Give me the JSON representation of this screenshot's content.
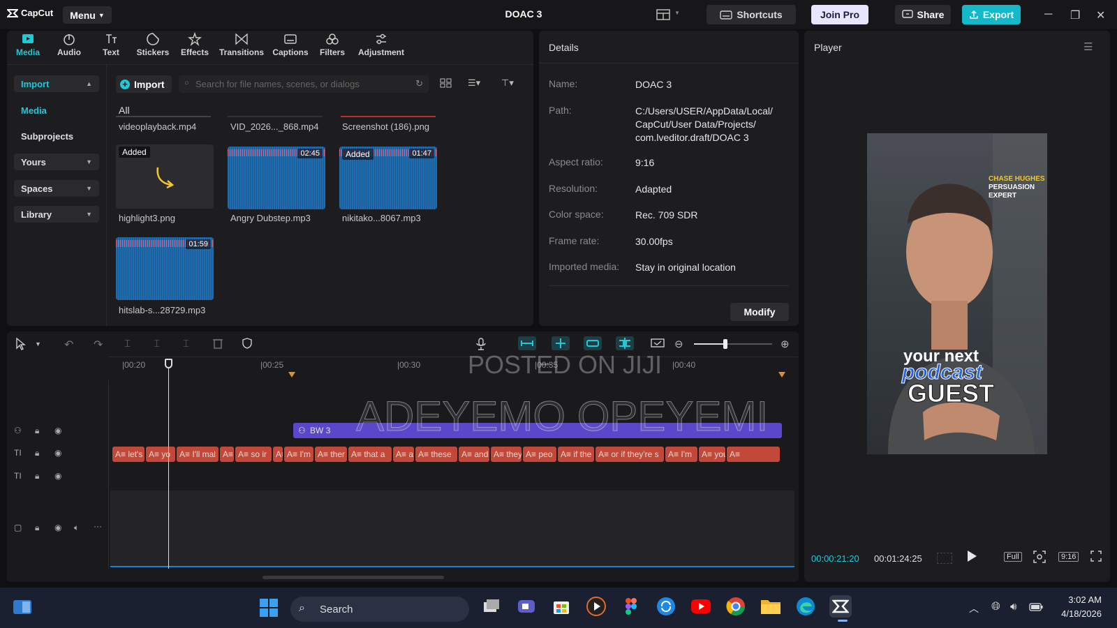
{
  "app": {
    "name": "CapCut",
    "menu_label": "Menu",
    "project_title": "DOAC 3"
  },
  "titlebar": {
    "shortcuts_label": "Shortcuts",
    "join_pro_label": "Join Pro",
    "share_label": "Share",
    "export_label": "Export"
  },
  "toolbar": {
    "tabs": [
      {
        "label": "Media",
        "icon": "media-icon"
      },
      {
        "label": "Audio",
        "icon": "audio-icon"
      },
      {
        "label": "Text",
        "icon": "text-icon"
      },
      {
        "label": "Stickers",
        "icon": "stickers-icon"
      },
      {
        "label": "Effects",
        "icon": "effects-icon"
      },
      {
        "label": "Transitions",
        "icon": "transitions-icon"
      },
      {
        "label": "Captions",
        "icon": "captions-icon"
      },
      {
        "label": "Filters",
        "icon": "filters-icon"
      },
      {
        "label": "Adjustment",
        "icon": "adjustment-icon"
      }
    ]
  },
  "sidebar": {
    "items": [
      {
        "label": "Import"
      },
      {
        "label": "Media"
      },
      {
        "label": "Subprojects"
      },
      {
        "label": "Yours"
      },
      {
        "label": "Spaces"
      },
      {
        "label": "Library"
      }
    ]
  },
  "media": {
    "import_button": "Import",
    "search_placeholder": "Search for file names, scenes, or dialogs",
    "filter_all": "All",
    "top_labels": [
      "videoplayback.mp4",
      "VID_2026..._868.mp4",
      "Screenshot (186).png"
    ],
    "items": [
      {
        "name": "highlight3.png",
        "badge": "Added",
        "duration": ""
      },
      {
        "name": "Angry Dubstep.mp3",
        "badge": "",
        "duration": "02:45"
      },
      {
        "name": "nikitako...8067.mp3",
        "badge": "Added",
        "duration": "01:47"
      },
      {
        "name": "hitslab-s...28729.mp3",
        "badge": "",
        "duration": "01:59"
      }
    ]
  },
  "details": {
    "header": "Details",
    "rows": [
      {
        "key": "Name:",
        "value": "DOAC 3"
      },
      {
        "key": "Path:",
        "value": "C:/Users/USER/AppData/Local/ CapCut/User Data/Projects/ com.lveditor.draft/DOAC 3"
      },
      {
        "key": "Aspect ratio:",
        "value": "9:16"
      },
      {
        "key": "Resolution:",
        "value": "Adapted"
      },
      {
        "key": "Color space:",
        "value": "Rec. 709 SDR"
      },
      {
        "key": "Frame rate:",
        "value": "30.00fps"
      },
      {
        "key": "Imported media:",
        "value": "Stay in original location"
      }
    ],
    "modify_button": "Modify"
  },
  "player": {
    "header": "Player",
    "current_time": "00:00:21:20",
    "total_time": "00:01:24:25",
    "full_label": "Full",
    "ratio_label": "9:16",
    "overlay": {
      "name_line1": "CHASE HUGHES",
      "name_line2": "PERSUASION",
      "name_line3": "EXPERT",
      "line1": "your next",
      "line2": "podcast",
      "line3": "GUEST"
    }
  },
  "timeline": {
    "ruler": [
      "00:20",
      "00:25",
      "00:30",
      "00:35",
      "00:40"
    ],
    "effect_clip_label": "BW 3",
    "caption_clips": [
      "let's",
      "yo",
      "I'll mal",
      "",
      "so ir",
      "",
      "I'm",
      "ther",
      "that a",
      "a",
      "these",
      "and",
      "they",
      "peo",
      "if the",
      "or if they're s",
      "I'm",
      "you m",
      ""
    ],
    "zoom_level": 0.4
  },
  "watermarks": {
    "line1": "POSTED ON JIJI",
    "line2": "ADEYEMO OPEYEMI"
  },
  "taskbar": {
    "search_label": "Search",
    "time": "3:02 AM",
    "date": "4/18/2026"
  },
  "colors": {
    "accent": "#1fc9d6",
    "caption_clip": "#c2493a",
    "effect_clip": "#5a47c9",
    "wave": "#1c6fb2",
    "join_pro": "#e8e6ff",
    "export": "#14b8c8"
  }
}
